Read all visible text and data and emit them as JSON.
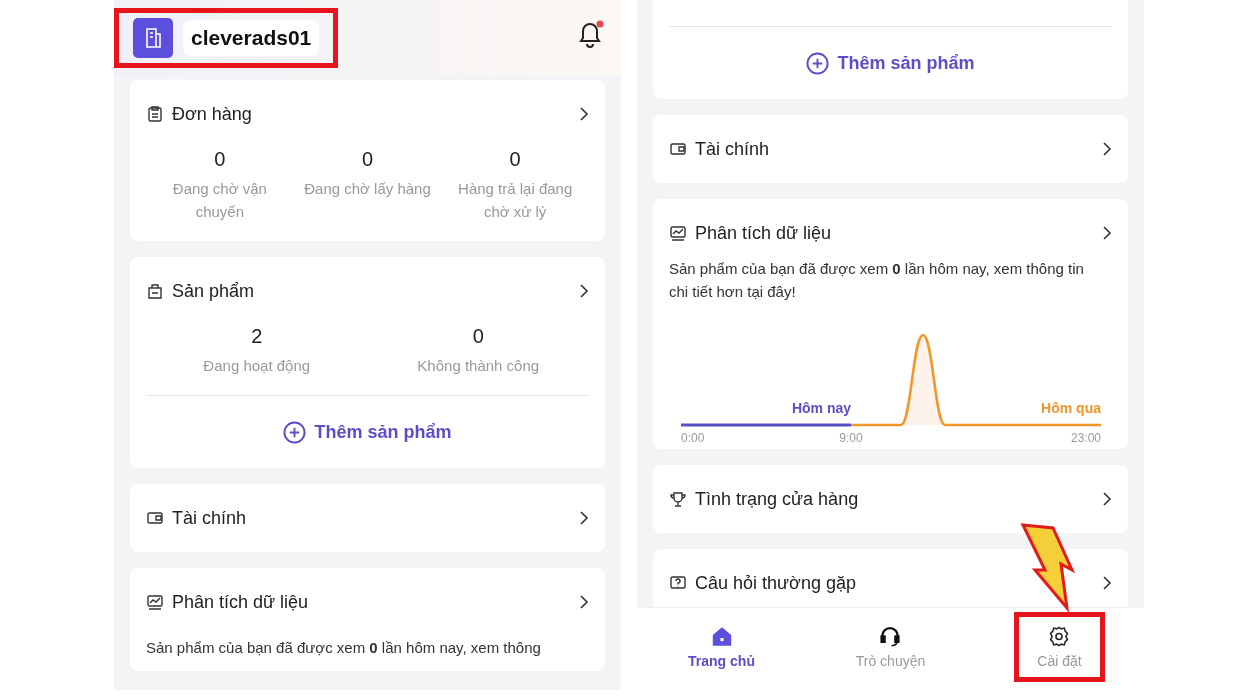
{
  "left_screen": {
    "header": {
      "shop_name": "cleverads01",
      "notification_unread": true,
      "highlighted": true
    },
    "cards": [
      {
        "kind": "orders",
        "title": "Đơn hàng",
        "stats": [
          {
            "value": "0",
            "label": "Đang chờ vận chuyển"
          },
          {
            "value": "0",
            "label": "Đang chờ lấy hàng"
          },
          {
            "value": "0",
            "label": "Hàng trả lại đang chờ xử lý"
          }
        ]
      },
      {
        "kind": "products",
        "title": "Sản phẩm",
        "stats": [
          {
            "value": "2",
            "label": "Đang hoạt động"
          },
          {
            "value": "0",
            "label": "Không thành công"
          }
        ],
        "action": "Thêm sản phẩm"
      },
      {
        "kind": "finance",
        "title": "Tài chính"
      },
      {
        "kind": "analytics",
        "title": "Phân tích dữ liệu",
        "text": "Sản phẩm của bạn đã được xem **0** lần hôm nay, xem thông"
      }
    ]
  },
  "right_screen": {
    "cards": [
      {
        "kind": "add_product",
        "action": "Thêm sản phẩm"
      },
      {
        "kind": "finance",
        "title": "Tài chính"
      },
      {
        "kind": "analytics",
        "title": "Phân tích dữ liệu",
        "text": "Sản phẩm của bạn đã được xem **0** lần hôm nay, xem thông tin chi tiết hơn tại đây!",
        "chart": {
          "today_label": "Hôm nay",
          "yesterday_label": "Hôm qua",
          "x_labels": [
            "0:00",
            "9:00",
            "23:00"
          ]
        }
      },
      {
        "kind": "store_status",
        "title": "Tình trạng cửa hàng"
      },
      {
        "kind": "faq",
        "title": "Câu hỏi thường gặp"
      }
    ],
    "nav": [
      {
        "kind": "home",
        "label": "Trang chủ",
        "selected": true,
        "highlighted": false
      },
      {
        "kind": "chat",
        "label": "Trò chuyện",
        "selected": false,
        "highlighted": false
      },
      {
        "kind": "settings",
        "label": "Cài đặt",
        "selected": false,
        "highlighted": true
      }
    ]
  }
}
